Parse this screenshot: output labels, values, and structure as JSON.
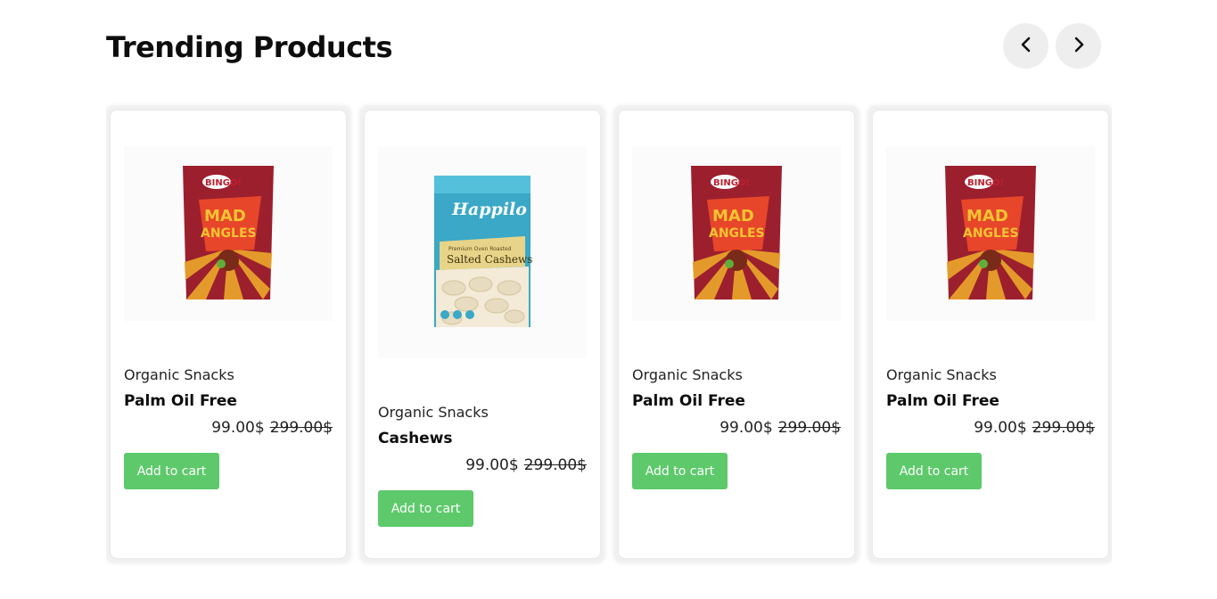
{
  "section": {
    "title": "Trending Products",
    "prev_icon": "chevron-left-icon",
    "next_icon": "chevron-right-icon"
  },
  "products": [
    {
      "category": "Organic Snacks",
      "name": "Palm Oil Free",
      "price": "99.00$",
      "old_price": "299.00$",
      "cart_label": "Add to cart",
      "image": "bingo-mad-angles-pack"
    },
    {
      "category": "Organic Snacks",
      "name": "Cashews",
      "price": "99.00$",
      "old_price": "299.00$",
      "cart_label": "Add to cart",
      "image": "happilo-salted-cashews-pack"
    },
    {
      "category": "Organic Snacks",
      "name": "Palm Oil Free",
      "price": "99.00$",
      "old_price": "299.00$",
      "cart_label": "Add to cart",
      "image": "bingo-mad-angles-pack"
    },
    {
      "category": "Organic Snacks",
      "name": "Palm Oil Free",
      "price": "99.00$",
      "old_price": "299.00$",
      "cart_label": "Add to cart",
      "image": "bingo-mad-angles-pack"
    }
  ],
  "brand_colors": {
    "cart_button": "#5dc96b",
    "nav_button_bg": "#eeeeee"
  }
}
